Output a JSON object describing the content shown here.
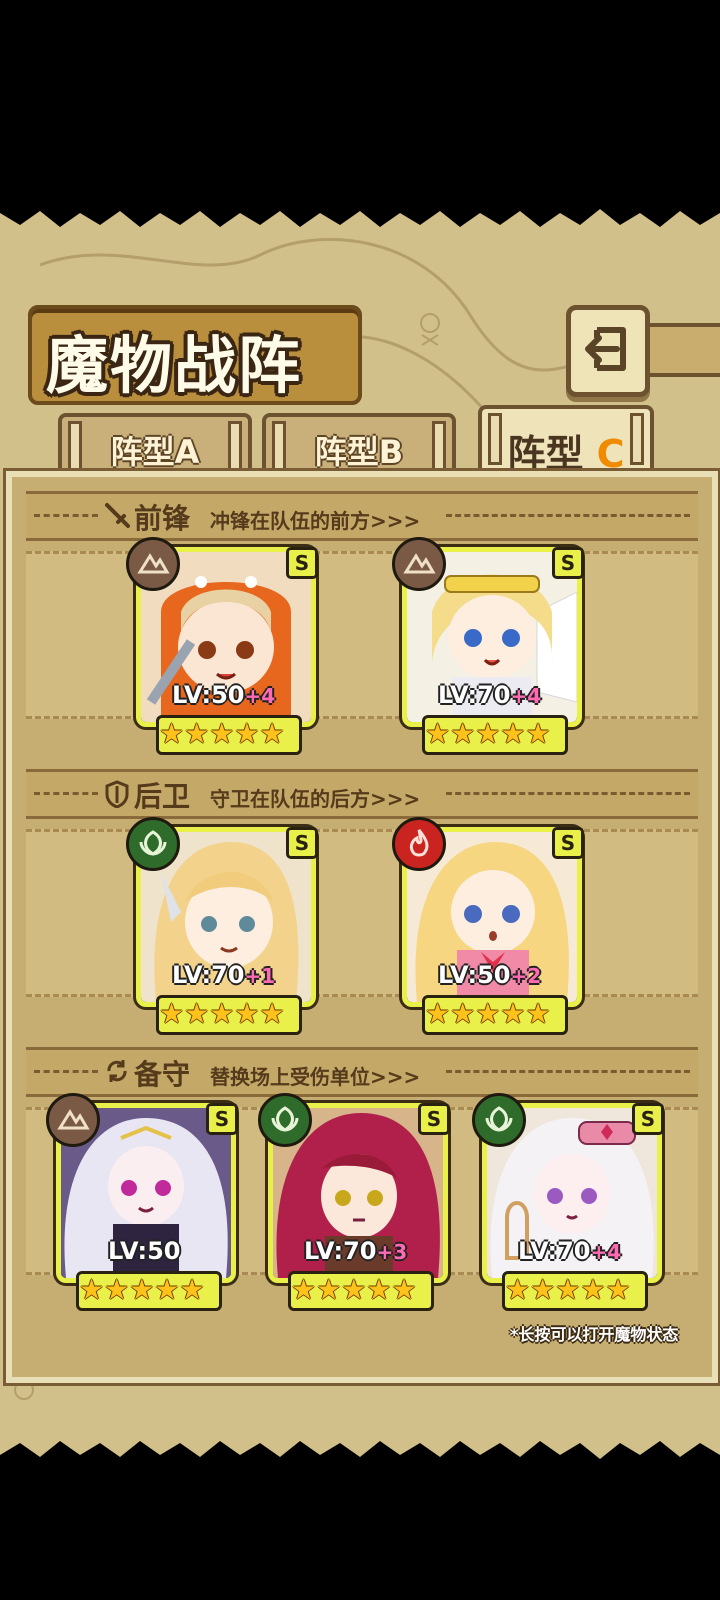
{
  "title": "魔物战阵",
  "tabs": [
    {
      "label": "阵型A",
      "active": false
    },
    {
      "label": "阵型B",
      "active": false
    },
    {
      "label_main": "阵型 ",
      "label_accent": "C",
      "active": true
    }
  ],
  "sections": {
    "front": {
      "name": "前锋",
      "desc": "冲锋在队伍的前方>>>",
      "icon": "sword-icon"
    },
    "rear": {
      "name": "后卫",
      "desc": "守卫在队伍的后方>>>",
      "icon": "shield-icon"
    },
    "reserve": {
      "name": "备守",
      "desc": "替换场上受伤单位>>>",
      "icon": "swap-icon"
    }
  },
  "cards": {
    "front": [
      {
        "grade": "S",
        "element": "earth",
        "level": "LV:50",
        "plus": "+4",
        "stars": 5
      },
      {
        "grade": "S",
        "element": "earth",
        "level": "LV:70",
        "plus": "+4",
        "stars": 5
      }
    ],
    "rear": [
      {
        "grade": "S",
        "element": "nature",
        "level": "LV:70",
        "plus": "+1",
        "stars": 5
      },
      {
        "grade": "S",
        "element": "fire",
        "level": "LV:50",
        "plus": "+2",
        "stars": 5
      }
    ],
    "reserve": [
      {
        "grade": "S",
        "element": "earth",
        "level": "LV:50",
        "plus": "",
        "stars": 5
      },
      {
        "grade": "S",
        "element": "nature",
        "level": "LV:70",
        "plus": "+3",
        "stars": 5
      },
      {
        "grade": "S",
        "element": "nature",
        "level": "LV:70",
        "plus": "+4",
        "stars": 5
      }
    ]
  },
  "hint": "*长按可以打开魔物状态",
  "colors": {
    "earth": "#7a5a44",
    "nature": "#2f6b2a",
    "fire": "#c9241f",
    "card_border": "#eaf04a",
    "accent": "#f08b00"
  }
}
